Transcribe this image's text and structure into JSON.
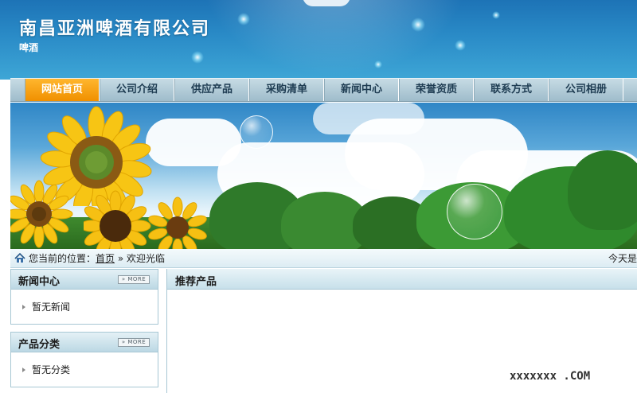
{
  "header": {
    "company_name": "南昌亚洲啤酒有限公司",
    "company_sub": "啤酒"
  },
  "nav": {
    "items": [
      {
        "label": "网站首页",
        "active": true
      },
      {
        "label": "公司介绍"
      },
      {
        "label": "供应产品"
      },
      {
        "label": "采购清单"
      },
      {
        "label": "新闻中心"
      },
      {
        "label": "荣誉资质"
      },
      {
        "label": "联系方式"
      },
      {
        "label": "公司相册"
      }
    ]
  },
  "breadcrumb": {
    "prefix": "您当前的位置：",
    "home_link": "首页",
    "separator": "»",
    "current": "欢迎光临",
    "today": "今天是"
  },
  "news_box": {
    "title": "新闻中心",
    "more": "MORE",
    "item": "暂无新闻"
  },
  "category_box": {
    "title": "产品分类",
    "more": "MORE",
    "item": "暂无分类"
  },
  "main": {
    "title": "推荐产品"
  },
  "watermark": {
    "text": "xxxxxxx   .COM"
  },
  "colors": {
    "nav_active": "#f5a00c",
    "header_blue": "#2a8bc7"
  }
}
